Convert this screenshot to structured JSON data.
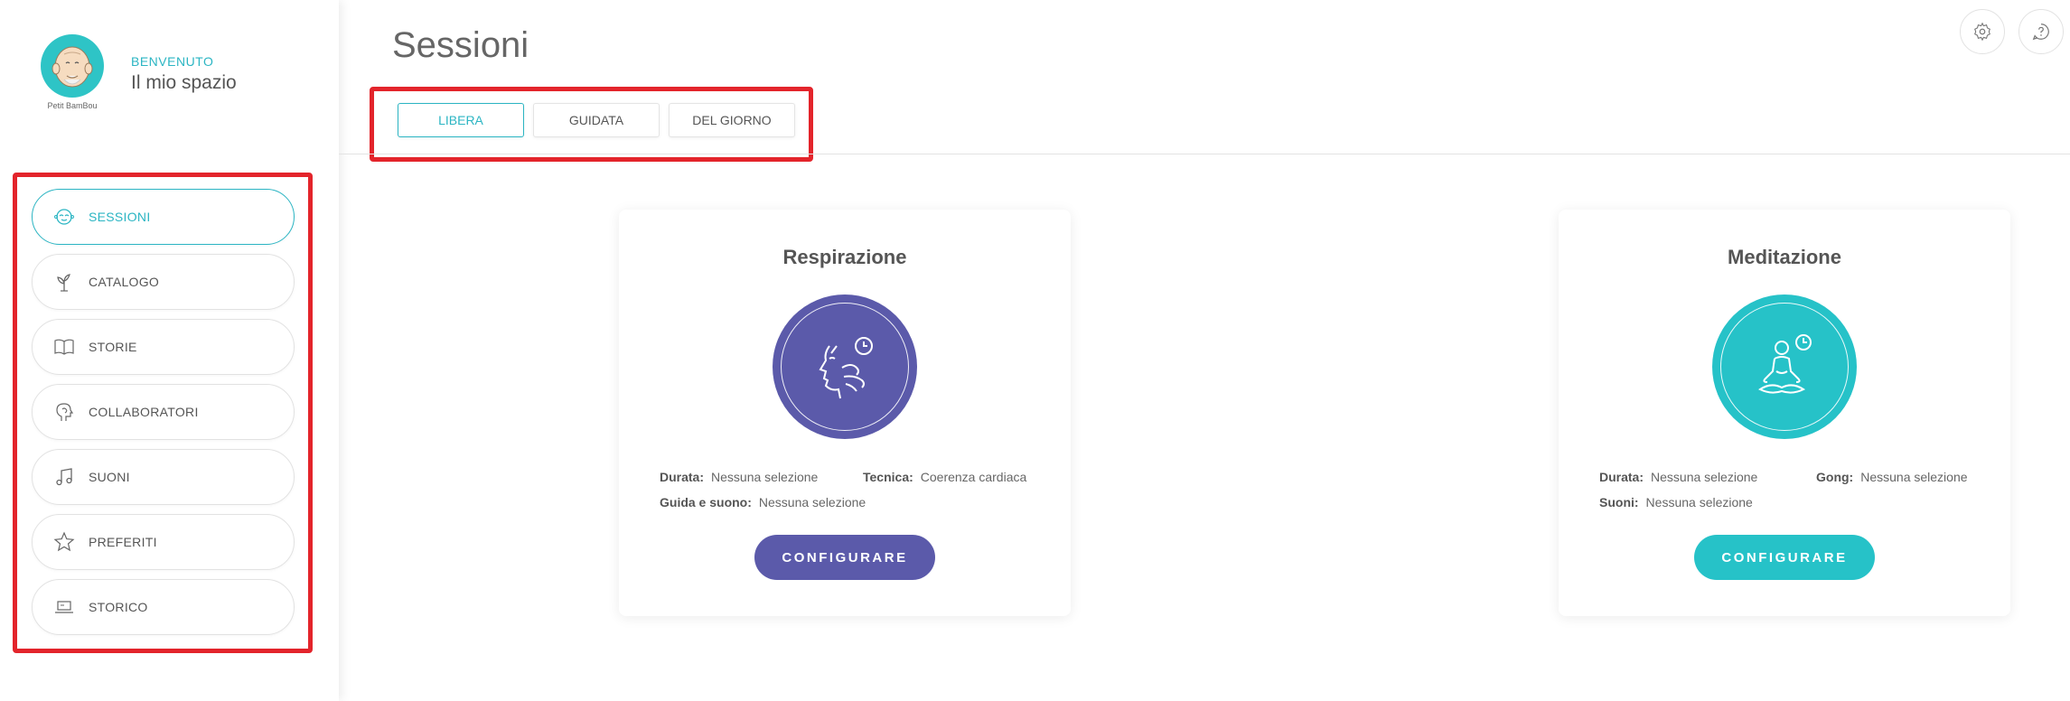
{
  "profile": {
    "avatar_caption": "Petit BamBou",
    "welcome_small": "BENVENUTO",
    "welcome_big": "Il mio spazio"
  },
  "sidebar": {
    "items": [
      {
        "label": "SESSIONI",
        "icon": "meditation-face-icon",
        "active": true
      },
      {
        "label": "CATALOGO",
        "icon": "sprout-icon",
        "active": false
      },
      {
        "label": "STORIE",
        "icon": "book-icon",
        "active": false
      },
      {
        "label": "COLLABORATORI",
        "icon": "head-profile-icon",
        "active": false
      },
      {
        "label": "SUONI",
        "icon": "music-note-icon",
        "active": false
      },
      {
        "label": "PREFERITI",
        "icon": "star-icon",
        "active": false
      },
      {
        "label": "STORICO",
        "icon": "laptop-icon",
        "active": false
      }
    ]
  },
  "header": {
    "title": "Sessioni",
    "icons": [
      "gear-icon",
      "help-icon"
    ]
  },
  "tabs": [
    {
      "label": "LIBERA",
      "active": true
    },
    {
      "label": "GUIDATA",
      "active": false
    },
    {
      "label": "DEL GIORNO",
      "active": false
    }
  ],
  "cards": {
    "breathing": {
      "title": "Respirazione",
      "color": "#5b5aaa",
      "durata_label": "Durata:",
      "durata_value": "Nessuna selezione",
      "tecnica_label": "Tecnica:",
      "tecnica_value": "Coerenza cardiaca",
      "guida_label": "Guida e suono:",
      "guida_value": "Nessuna selezione",
      "button": "CONFIGURARE"
    },
    "meditation": {
      "title": "Meditazione",
      "color": "#26c2c8",
      "durata_label": "Durata:",
      "durata_value": "Nessuna selezione",
      "gong_label": "Gong:",
      "gong_value": "Nessuna selezione",
      "suoni_label": "Suoni:",
      "suoni_value": "Nessuna selezione",
      "button": "CONFIGURARE"
    }
  },
  "colors": {
    "accent": "#2bb5c3",
    "highlight_border": "#e3242b"
  }
}
